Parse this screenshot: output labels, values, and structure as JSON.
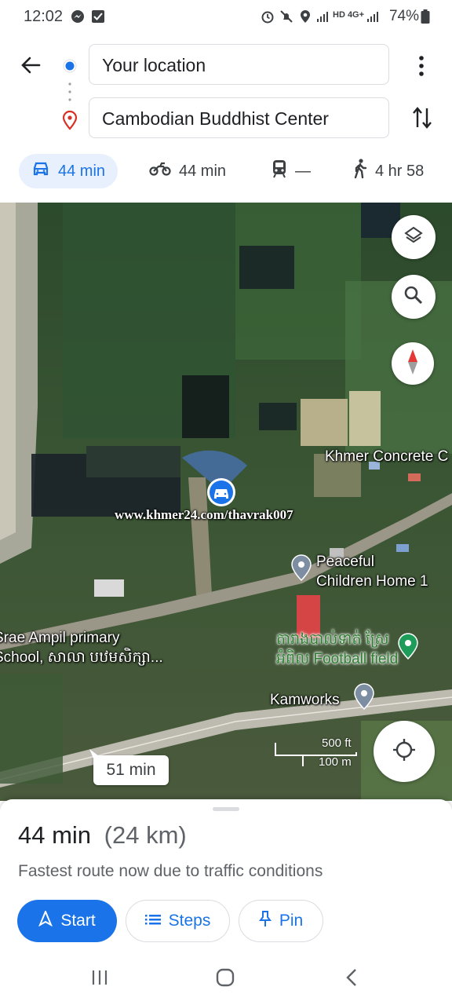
{
  "status_bar": {
    "time": "12:02",
    "network": "HD 4G+",
    "battery": "74%"
  },
  "directions": {
    "origin": "Your location",
    "destination": "Cambodian Buddhist Center",
    "modes": [
      {
        "icon": "car-icon",
        "label": "44 min",
        "active": true
      },
      {
        "icon": "motorcycle-icon",
        "label": "44 min",
        "active": false
      },
      {
        "icon": "transit-icon",
        "label": "—",
        "active": false
      },
      {
        "icon": "walk-icon",
        "label": "4 hr 58",
        "active": false
      }
    ]
  },
  "map": {
    "labels": {
      "khmer_concrete": "Khmer Concrete C",
      "watermark": "www.khmer24.com/thavrak007",
      "peaceful_1": "Peaceful",
      "peaceful_2": "Children Home 1",
      "school_1": "Srae Ampil primary",
      "school_2": "School, សាលា បឋមសិក្សា...",
      "football_1": "តារាងបាល់ទាត់ ស្រែ",
      "football_2": "អំពិល Football field",
      "kamworks": "Kamworks",
      "alt_route": "51 min"
    },
    "scale": {
      "top": "500 ft",
      "bottom": "100 m"
    },
    "accent": "#1a73e8"
  },
  "route_summary": {
    "duration": "44 min",
    "distance": "(24 km)",
    "note": "Fastest route now due to traffic conditions",
    "buttons": {
      "start": "Start",
      "steps": "Steps",
      "pin": "Pin"
    }
  }
}
